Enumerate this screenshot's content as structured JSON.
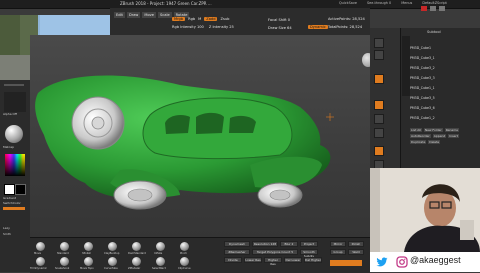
{
  "app": {
    "title": "ZBrush 2018 - Project: 1947 Green Car.ZPR ...",
    "menu_right": [
      "QuickSave",
      "See-through 0",
      "Menus",
      "DefaultZScript"
    ]
  },
  "toolbar": {
    "mode_buttons": [
      "Edit",
      "Draw",
      "Move",
      "Scale",
      "Rotate"
    ],
    "mrgb": "Mrgb",
    "rgb": "Rgb",
    "m": "M",
    "zadd": "Zadd",
    "zsub": "Zsub",
    "focal_label": "Focal Shift 0",
    "draw_size_label": "Draw Size 64",
    "active_points": "ActivePoints: 28,524",
    "total_points": "TotalPoints: 28,524",
    "dynamic": "Dynamic",
    "rgb_intensity": "Rgb Intensity 100",
    "z_intensity": "Z Intensity 25"
  },
  "left_panel": {
    "items": [
      "Alpha Off",
      "Texture Off",
      "Matcap",
      "Gradient",
      "SwitchColor",
      "Alternate"
    ],
    "small_labels": [
      "Lz",
      "Lazy",
      "Smth"
    ]
  },
  "right_panel": {
    "title": "Subtool",
    "layers": [
      "PM3D_Cube1",
      "PM3D_Cube3_1",
      "PM3D_Cube3_2",
      "PM3D_Cube3_3",
      "PM3D_Cube1_1",
      "PM3D_Cube3_5",
      "PM3D_Cube3_6",
      "PM3D_Cube1_2"
    ],
    "buttons": [
      "List All",
      "New Folder",
      "Rename",
      "AutoReorder",
      "Append",
      "Insert",
      "Duplicate",
      "Delete"
    ]
  },
  "bottom_panel": {
    "brush_labels": [
      "Move",
      "Standard",
      "hPolish",
      "ClayBuildup",
      "DamStandard",
      "Inflate",
      "Pinch",
      "TrimDynamic",
      "Snakehook",
      "Move Topo",
      "CurveTube",
      "ZModeler",
      "SelectRect",
      "ClipCurve"
    ],
    "right_items": [
      "Dynamesh",
      "Resolution 128",
      "Blur 2",
      "Project",
      "ZRemesher",
      "Target Polygons Count 5",
      "Smooth Subdiv",
      "Divide",
      "Lower Res",
      "Higher Res",
      "Del Lower",
      "Del Higher"
    ],
    "extra": [
      "Mirror",
      "Polish",
      "Group",
      "Weld"
    ]
  },
  "social": {
    "handle": "@akaeggest",
    "twitter_icon": "twitter-icon",
    "instagram_icon": "instagram-icon"
  },
  "colors": {
    "accent": "#e07c1f",
    "car_green": "#2f9a37",
    "panel_bg": "#2a2a2a"
  }
}
